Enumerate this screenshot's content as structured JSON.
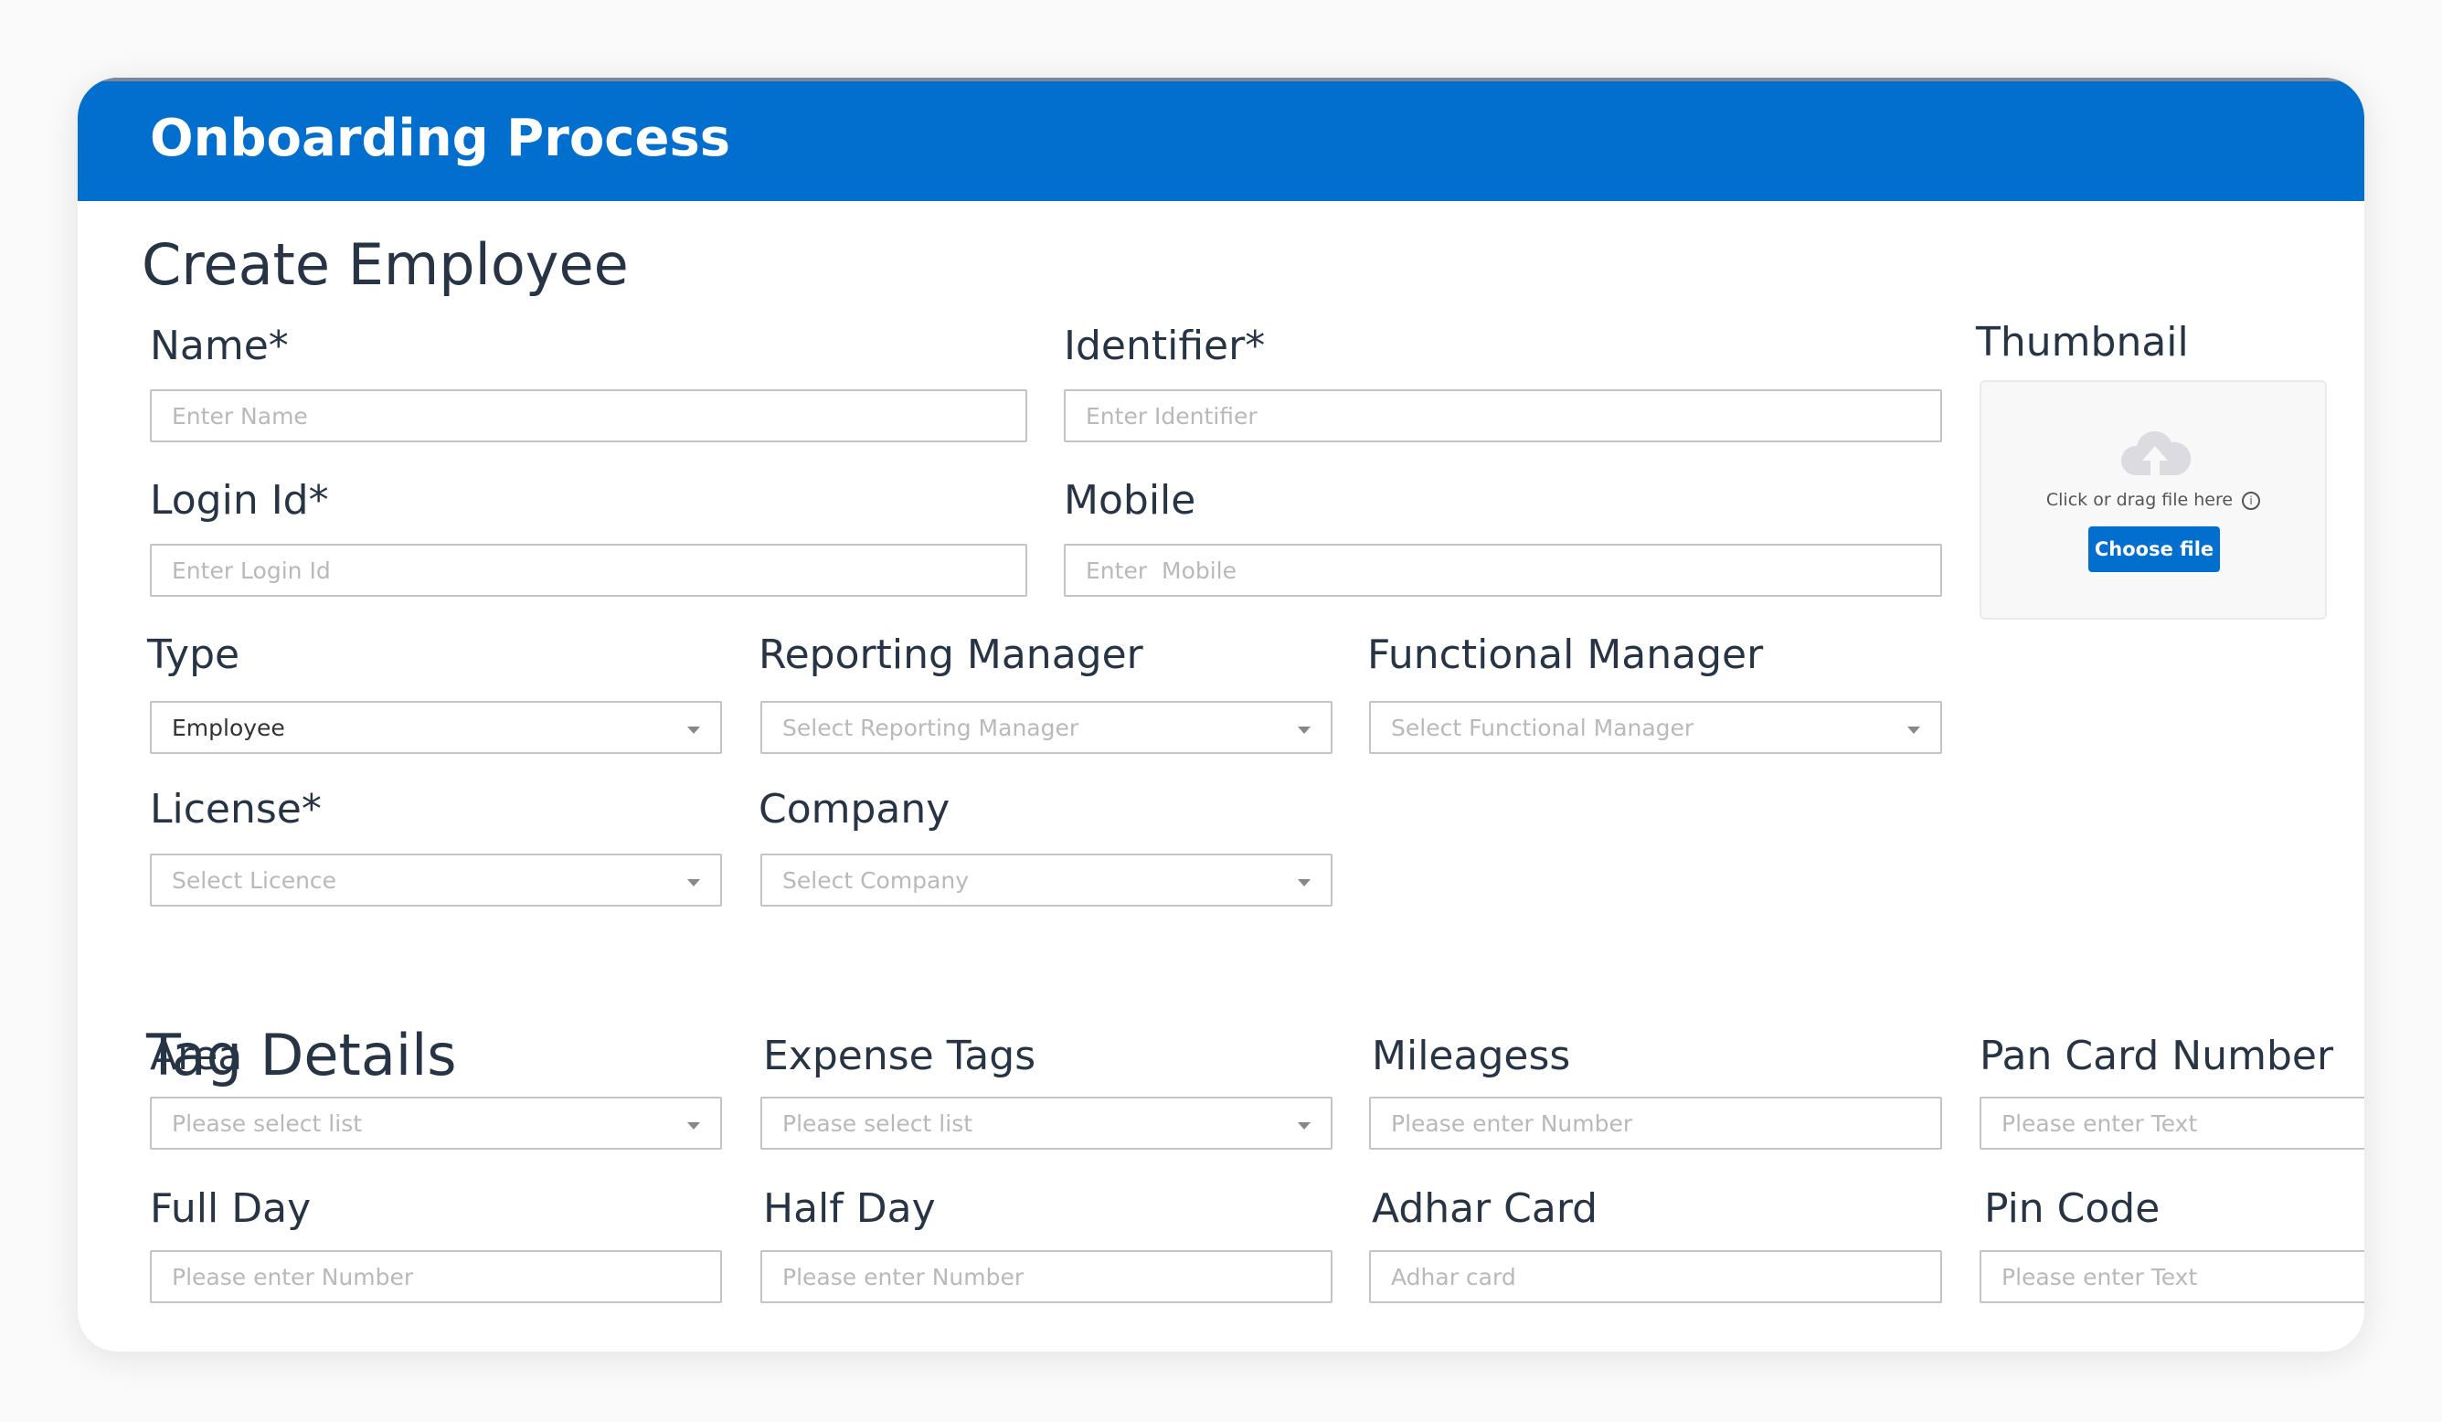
{
  "header": {
    "title": "Onboarding Process"
  },
  "create_employee": {
    "title": "Create Employee",
    "name": {
      "label": "Name*",
      "placeholder": "Enter Name"
    },
    "identifier": {
      "label": "Identifier*",
      "placeholder": "Enter Identifier"
    },
    "login_id": {
      "label": "Login Id*",
      "placeholder": "Enter Login Id"
    },
    "mobile": {
      "label": "Mobile",
      "placeholder": "Enter  Mobile"
    },
    "type": {
      "label": "Type",
      "value": "Employee"
    },
    "reporting_manager": {
      "label": "Reporting Manager",
      "placeholder": "Select Reporting Manager"
    },
    "functional_manager": {
      "label": "Functional Manager",
      "placeholder": "Select Functional Manager"
    },
    "license": {
      "label": "License*",
      "placeholder": "Select Licence"
    },
    "company": {
      "label": "Company",
      "placeholder": "Select Company"
    },
    "thumbnail": {
      "label": "Thumbnail",
      "hint": "Click or drag file here",
      "info_icon": "info-circle-icon",
      "upload_icon": "cloud-upload-icon",
      "button": "Choose file"
    }
  },
  "tag_details": {
    "title": "Tag Details",
    "area": {
      "label": "Area",
      "placeholder": "Please select list"
    },
    "expense_tags": {
      "label": "Expense Tags",
      "placeholder": "Please select list"
    },
    "mileagess": {
      "label": "Mileagess",
      "placeholder": "Please enter Number"
    },
    "pan_card": {
      "label": "Pan Card Number",
      "placeholder": "Please enter Text"
    },
    "full_day": {
      "label": "Full Day",
      "placeholder": "Please enter Number"
    },
    "half_day": {
      "label": "Half Day",
      "placeholder": "Please enter Number"
    },
    "adhar_card": {
      "label": "Adhar Card",
      "placeholder": "Adhar card"
    },
    "pin_code": {
      "label": "Pin Code",
      "placeholder": "Please enter Text"
    }
  },
  "colors": {
    "primary": "#026fce",
    "text": "#263445",
    "border": "#c4c4c4"
  }
}
